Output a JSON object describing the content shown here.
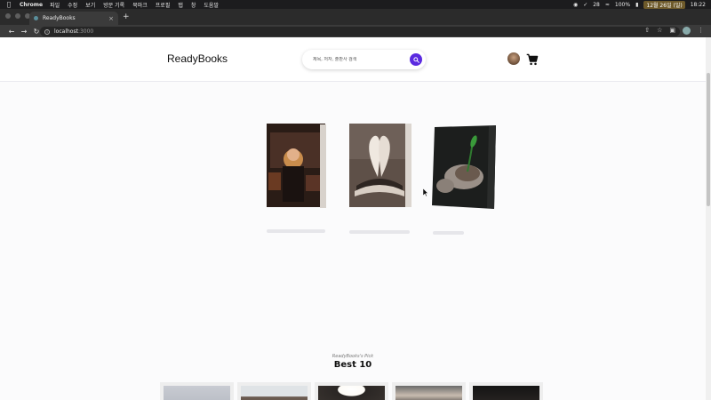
{
  "menubar": {
    "app": "Chrome",
    "items": [
      "파일",
      "수정",
      "보기",
      "방문 기록",
      "북마크",
      "프로필",
      "탭",
      "창",
      "도움말"
    ],
    "status_count": "28",
    "battery": "100%",
    "date": "12월 26일 (일)",
    "time": "18:22"
  },
  "browser": {
    "tab_title": "ReadyBooks",
    "url_host": "localhost",
    "url_port": ":3000"
  },
  "header": {
    "logo": "ReadyBooks",
    "search_placeholder": "제목, 저자, 출판사 검색"
  },
  "carousel": {
    "books": [
      {
        "name": "book-woman-reading",
        "colors": [
          "#3a2a22",
          "#c88a4a",
          "#1e1612"
        ]
      },
      {
        "name": "book-heart-pages",
        "colors": [
          "#6a5a50",
          "#e6ddd4",
          "#2e2622"
        ]
      },
      {
        "name": "book-seedling-hands",
        "colors": [
          "#1f2120",
          "#9a9088",
          "#3a8a3a"
        ]
      }
    ]
  },
  "best": {
    "subtitle": "ReadyBooks's Pick",
    "title": "Best 10"
  },
  "colors": {
    "accent": "#5b2be0"
  }
}
